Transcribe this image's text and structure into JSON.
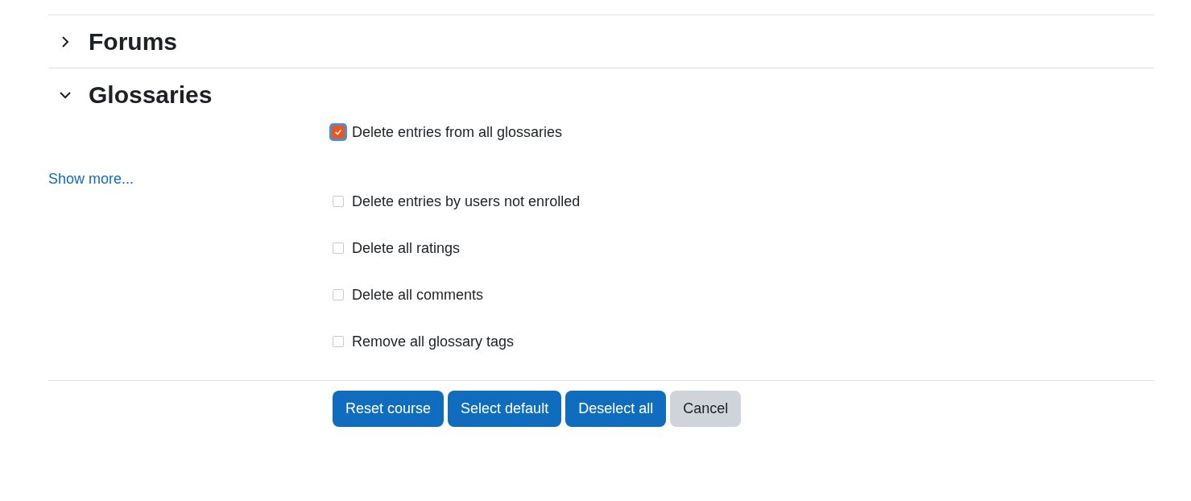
{
  "sections": [
    {
      "title": "Forums",
      "expanded": false
    },
    {
      "title": "Glossaries",
      "expanded": true
    }
  ],
  "primary_option": {
    "label": "Delete entries from all glossaries",
    "checked": true,
    "focused": true
  },
  "show_more_link": "Show more...",
  "options": [
    {
      "label": "Delete entries by users not enrolled",
      "checked": false
    },
    {
      "label": "Delete all ratings",
      "checked": false
    },
    {
      "label": "Delete all comments",
      "checked": false
    },
    {
      "label": "Remove all glossary tags",
      "checked": false
    }
  ],
  "buttons": [
    {
      "label": "Reset course",
      "kind": "primary"
    },
    {
      "label": "Select default",
      "kind": "primary"
    },
    {
      "label": "Deselect all",
      "kind": "primary"
    },
    {
      "label": "Cancel",
      "kind": "secondary"
    }
  ]
}
